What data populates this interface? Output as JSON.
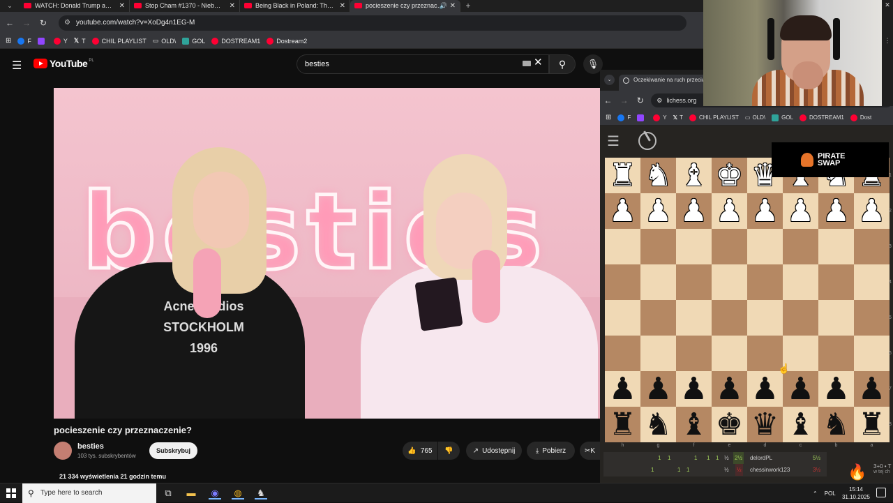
{
  "browser": {
    "tabs": [
      {
        "label": "WATCH: Donald Trump and Xi Ji",
        "active": false
      },
      {
        "label": "Stop Cham #1370 - Niebezpiecz",
        "active": false
      },
      {
        "label": "Being Black in Poland: The Truth",
        "active": false
      },
      {
        "label": "pocieszenie czy przeznaczenie",
        "active": true
      }
    ],
    "url": "youtube.com/watch?v=XoDg4n1EG-M",
    "bookmarks": [
      "F",
      "Y",
      "T",
      "CHIL PLAYLIST",
      "OLD\\",
      "GOL",
      "DOSTREAM1",
      "Dostream2"
    ]
  },
  "youtube": {
    "logo": "YouTube",
    "region": "PL",
    "search_value": "besties",
    "video": {
      "title": "pocieszenie czy przeznaczenie?",
      "channel": "besties",
      "subscribers": "103 tys. subskrybentów",
      "subscribe_label": "Subskrybuj",
      "likes": "765",
      "share_label": "Udostępnij",
      "download_label": "Pobierz",
      "clip_label": "K",
      "views": "21 334 wyświetlenia  21 godzin temu",
      "frame_neon_text": "besties",
      "shirt_text": "Acne Studios STOCKHOLM 1996"
    }
  },
  "lichess": {
    "tab_title": "Oczekiwanie na ruch przeciwnika",
    "url": "lichess.org",
    "bookmarks": [
      "F",
      "Y",
      "T",
      "CHIL PLAYLIST",
      "OLD\\",
      "GOL",
      "DOSTREAM1",
      "Dost"
    ],
    "ad_text": "PIRATE SWAP",
    "files": [
      "h",
      "g",
      "f",
      "e",
      "d",
      "c",
      "b",
      "a"
    ],
    "ranks": [
      "1",
      "2",
      "3",
      "4",
      "5",
      "6",
      "7",
      "8"
    ],
    "board": [
      [
        "wR",
        "wN",
        "wB",
        "wK",
        "wQ",
        "wB",
        "wN",
        "wR"
      ],
      [
        "wP",
        "wP",
        "wP",
        "wP",
        "wP",
        "wP",
        "wP",
        "wP"
      ],
      [
        "",
        "",
        "",
        "",
        "",
        "",
        "",
        ""
      ],
      [
        "",
        "",
        "",
        "",
        "",
        "",
        "",
        ""
      ],
      [
        "",
        "",
        "",
        "",
        "",
        "",
        "",
        ""
      ],
      [
        "",
        "",
        "",
        "",
        "",
        "",
        "",
        ""
      ],
      [
        "bP",
        "bP",
        "bP",
        "bP",
        "bP",
        "bP",
        "bP",
        "bP"
      ],
      [
        "bR",
        "bN",
        "bB",
        "bK",
        "bQ",
        "bB",
        "bN",
        "bR"
      ]
    ],
    "crosstable": [
      {
        "scores": [
          "1",
          "1",
          "1",
          "1",
          "1",
          "½",
          "2½"
        ],
        "player": "delordPL",
        "total": "5½",
        "color": "green"
      },
      {
        "scores": [
          "1",
          "1",
          "1",
          "½",
          "½"
        ],
        "player": "chessinwork123",
        "total": "3½",
        "color": "red"
      }
    ],
    "side_text": "3+0 • T",
    "side_text2": "w tej ch"
  },
  "taskbar": {
    "search_placeholder": "Type here to search",
    "language": "POL",
    "time": "15:14",
    "date": "31.10.2025"
  }
}
